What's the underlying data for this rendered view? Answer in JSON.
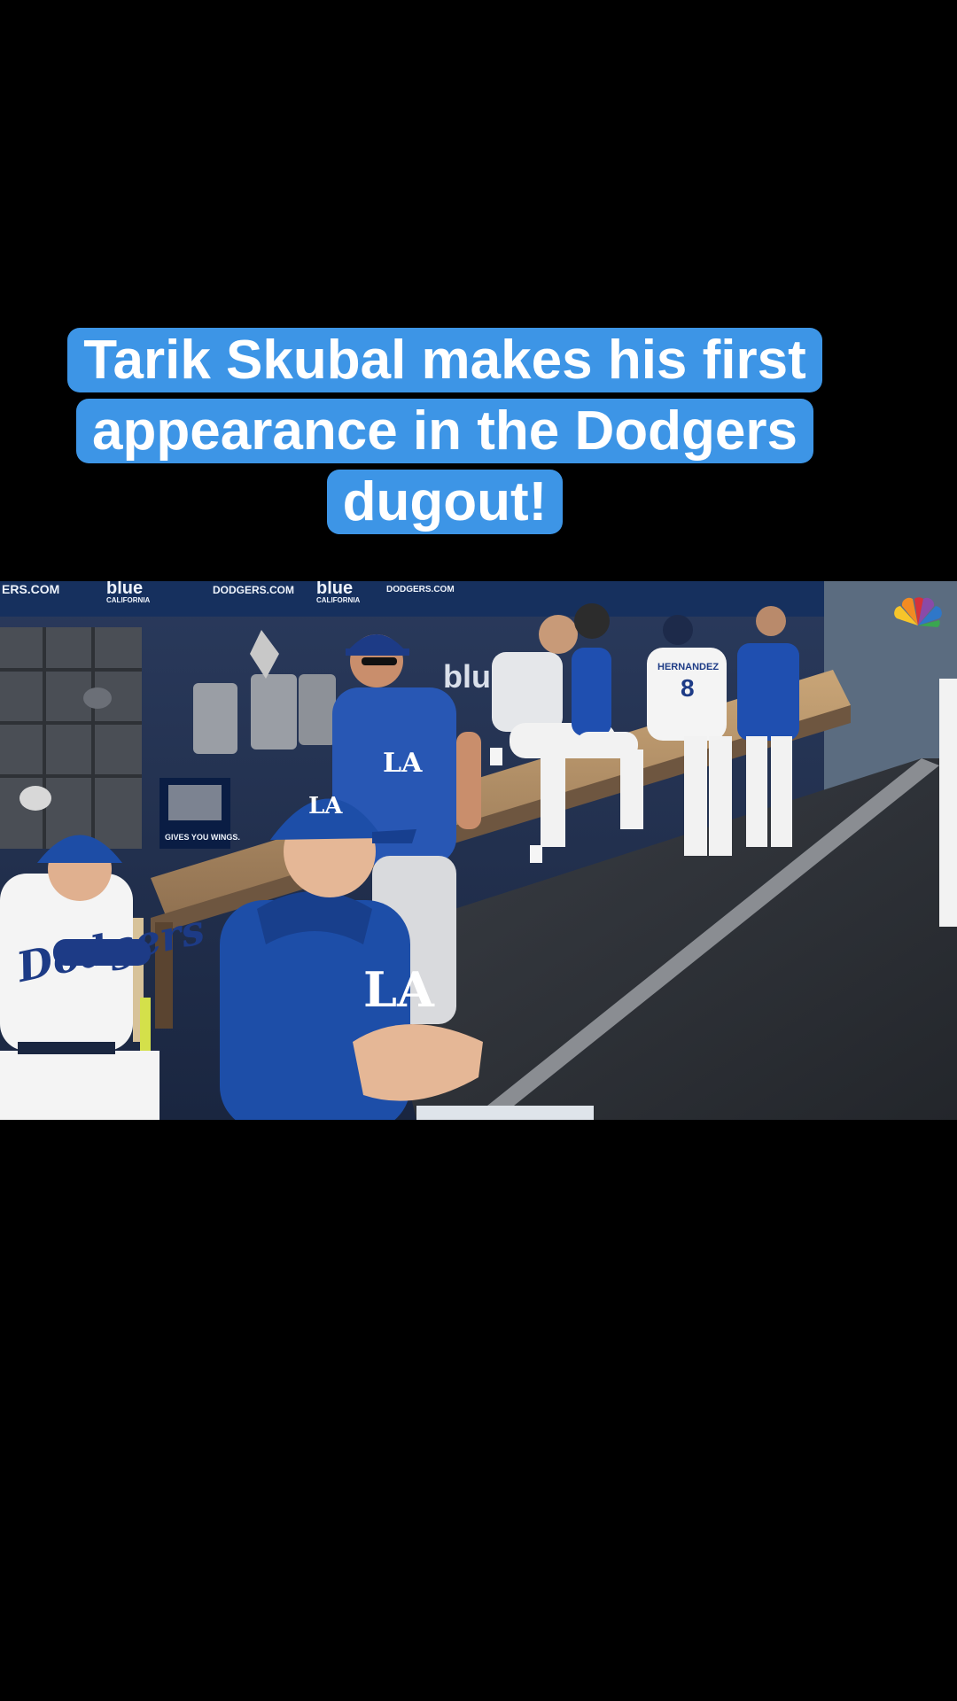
{
  "caption": {
    "lines": [
      "Tarik Skubal makes his first",
      "appearance in the Dodgers",
      "dugout!"
    ]
  },
  "video": {
    "signage": {
      "url_partial_left": "ERS.COM",
      "url_partial": "DODGERS.COM",
      "sponsor": "blue",
      "sponsor_sub": "CALIFORNIA",
      "ad_banner": "GIVES YOU WINGS.",
      "jersey_script": "Dodgers",
      "cap_logo": "LA",
      "player_number": "8",
      "player_name": "HERNANDEZ"
    },
    "network_logo_icon": "peacock-icon"
  }
}
